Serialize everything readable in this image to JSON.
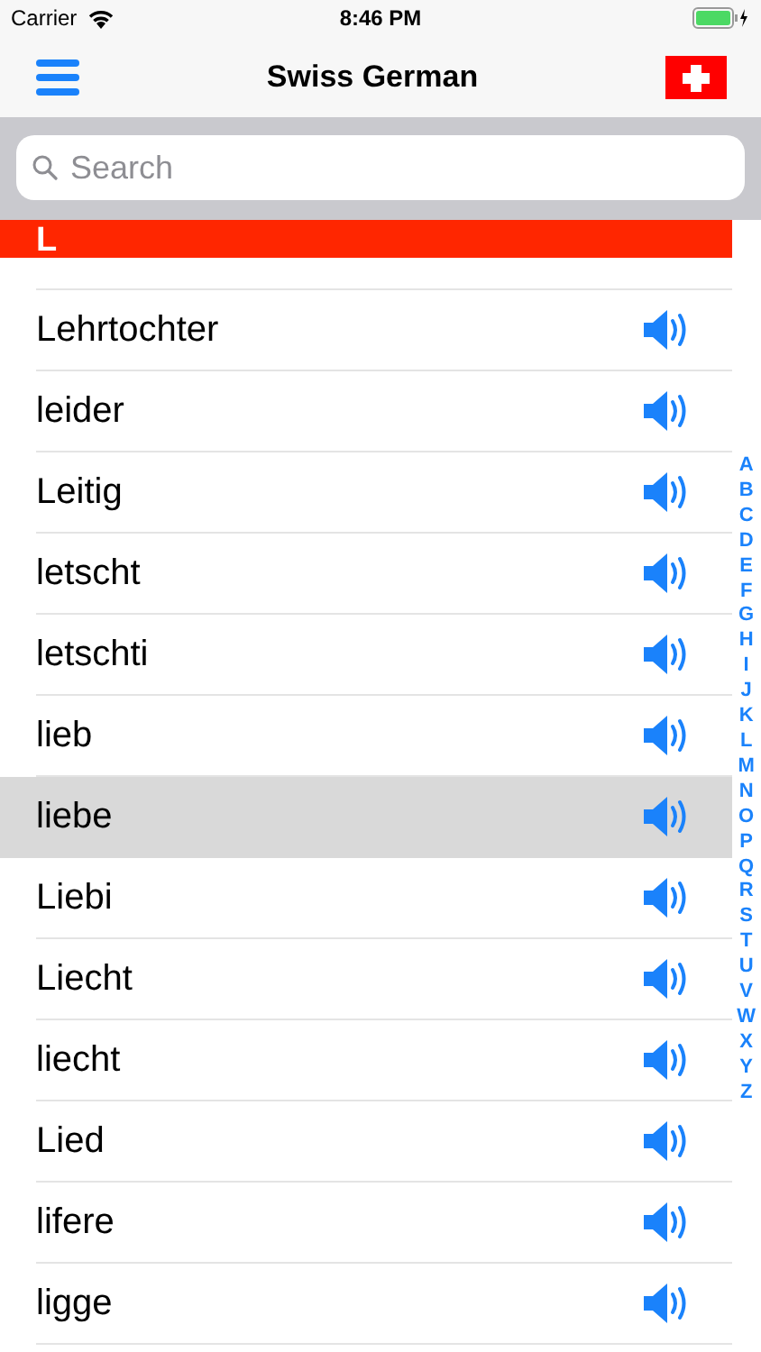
{
  "status_bar": {
    "carrier": "Carrier",
    "time": "8:46 PM"
  },
  "nav": {
    "title": "Swiss German"
  },
  "search": {
    "placeholder": "Search"
  },
  "section": {
    "header": "L"
  },
  "rows": [
    {
      "word": "Lehrtochter",
      "selected": false
    },
    {
      "word": "leider",
      "selected": false
    },
    {
      "word": "Leitig",
      "selected": false
    },
    {
      "word": "letscht",
      "selected": false
    },
    {
      "word": "letschti",
      "selected": false
    },
    {
      "word": "lieb",
      "selected": false
    },
    {
      "word": "liebe",
      "selected": true
    },
    {
      "word": "Liebi",
      "selected": false
    },
    {
      "word": "Liecht",
      "selected": false
    },
    {
      "word": "liecht",
      "selected": false
    },
    {
      "word": "Lied",
      "selected": false
    },
    {
      "word": "lifere",
      "selected": false
    },
    {
      "word": "ligge",
      "selected": false
    }
  ],
  "index": [
    "A",
    "B",
    "C",
    "D",
    "E",
    "F",
    "G",
    "H",
    "I",
    "J",
    "K",
    "L",
    "M",
    "N",
    "O",
    "P",
    "Q",
    "R",
    "S",
    "T",
    "U",
    "V",
    "W",
    "X",
    "Y",
    "Z"
  ]
}
